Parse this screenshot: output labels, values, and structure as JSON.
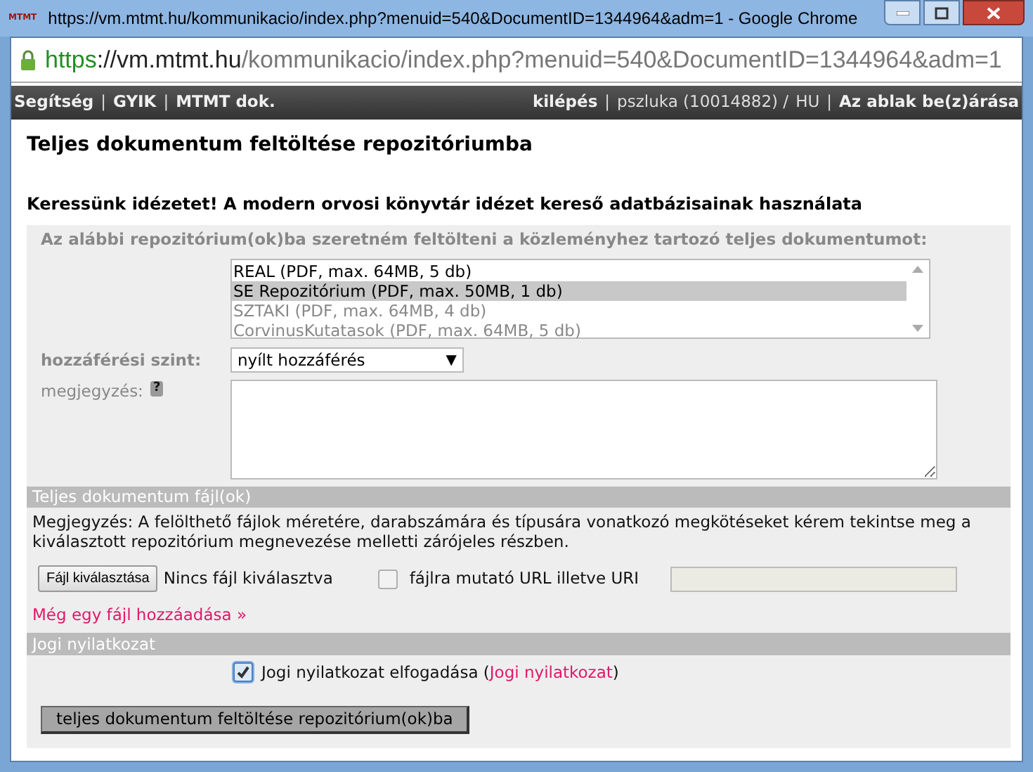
{
  "window": {
    "title": "https://vm.mtmt.hu/kommunikacio/index.php?menuid=540&DocumentID=1344964&adm=1 - Google Chrome",
    "logo": "MTMT"
  },
  "address": {
    "scheme": "https",
    "host": "://vm.mtmt.hu",
    "path": "/kommunikacio/index.php?menuid=540&DocumentID=1344964&adm=1"
  },
  "nav_left": [
    {
      "kind": "link",
      "text": "Segítség"
    },
    {
      "kind": "sep",
      "text": "|"
    },
    {
      "kind": "link",
      "text": "GYIK"
    },
    {
      "kind": "sep",
      "text": "|"
    },
    {
      "kind": "link",
      "text": "MTMT dok."
    }
  ],
  "nav_right": [
    {
      "kind": "link",
      "text": "kilépés"
    },
    {
      "kind": "sep",
      "text": "|"
    },
    {
      "kind": "text",
      "text": "pszluka (10014882) /"
    },
    {
      "kind": "text",
      "text": "HU"
    },
    {
      "kind": "sep",
      "text": "|"
    },
    {
      "kind": "link",
      "text": "Az ablak be(z)árása"
    }
  ],
  "heading": "Teljes dokumentum feltöltése repozitóriumba",
  "subheading": "Keressünk idézetet! A modern orvosi könyvtár idézet kereső adatbázisainak használata",
  "repositories": {
    "label": "Az alábbi repozitórium(ok)ba szeretném feltölteni a közleményhez tartozó teljes dokumentumot:",
    "items": [
      {
        "label": "REAL (PDF, max. 64MB, 5 db)",
        "selected": false,
        "disabled": false
      },
      {
        "label": "SE Repozitórium (PDF, max. 50MB, 1 db)",
        "selected": true,
        "disabled": false
      },
      {
        "label": "SZTAKI (PDF, max. 64MB, 4 db)",
        "selected": false,
        "disabled": true
      },
      {
        "label": "CorvinusKutatasok (PDF, max. 64MB, 5 db)",
        "selected": false,
        "disabled": true
      }
    ]
  },
  "access": {
    "label": "hozzáférési szint:",
    "value": "nyílt hozzáférés",
    "arrow": "▼"
  },
  "note": {
    "label": "megjegyzés:",
    "help": "?"
  },
  "files_section": {
    "title": "Teljes dokumentum fájl(ok)",
    "notice": "Megjegyzés: A felölthető fájlok méretére, darabszámára és típusára vonatkozó megkötéseket kérem tekintse meg a kiválasztott repozitórium megnevezése melletti zárójeles részben.",
    "file_button": "Fájl kiválasztása",
    "file_status": "Nincs fájl kiválasztva",
    "url_checkbox": {
      "label": "fájlra mutató URL illetve URI",
      "checked": false
    },
    "add_link": "Még egy fájl hozzáadása »"
  },
  "legal_section": {
    "title": "Jogi nyilatkozat",
    "checkbox": {
      "checked": true,
      "before": "Jogi nyilatkozat elfogadása (",
      "link": "Jogi nyilatkozat",
      "after": ")"
    }
  },
  "submit": "teljes dokumentum feltöltése repozitórium(ok)ba"
}
